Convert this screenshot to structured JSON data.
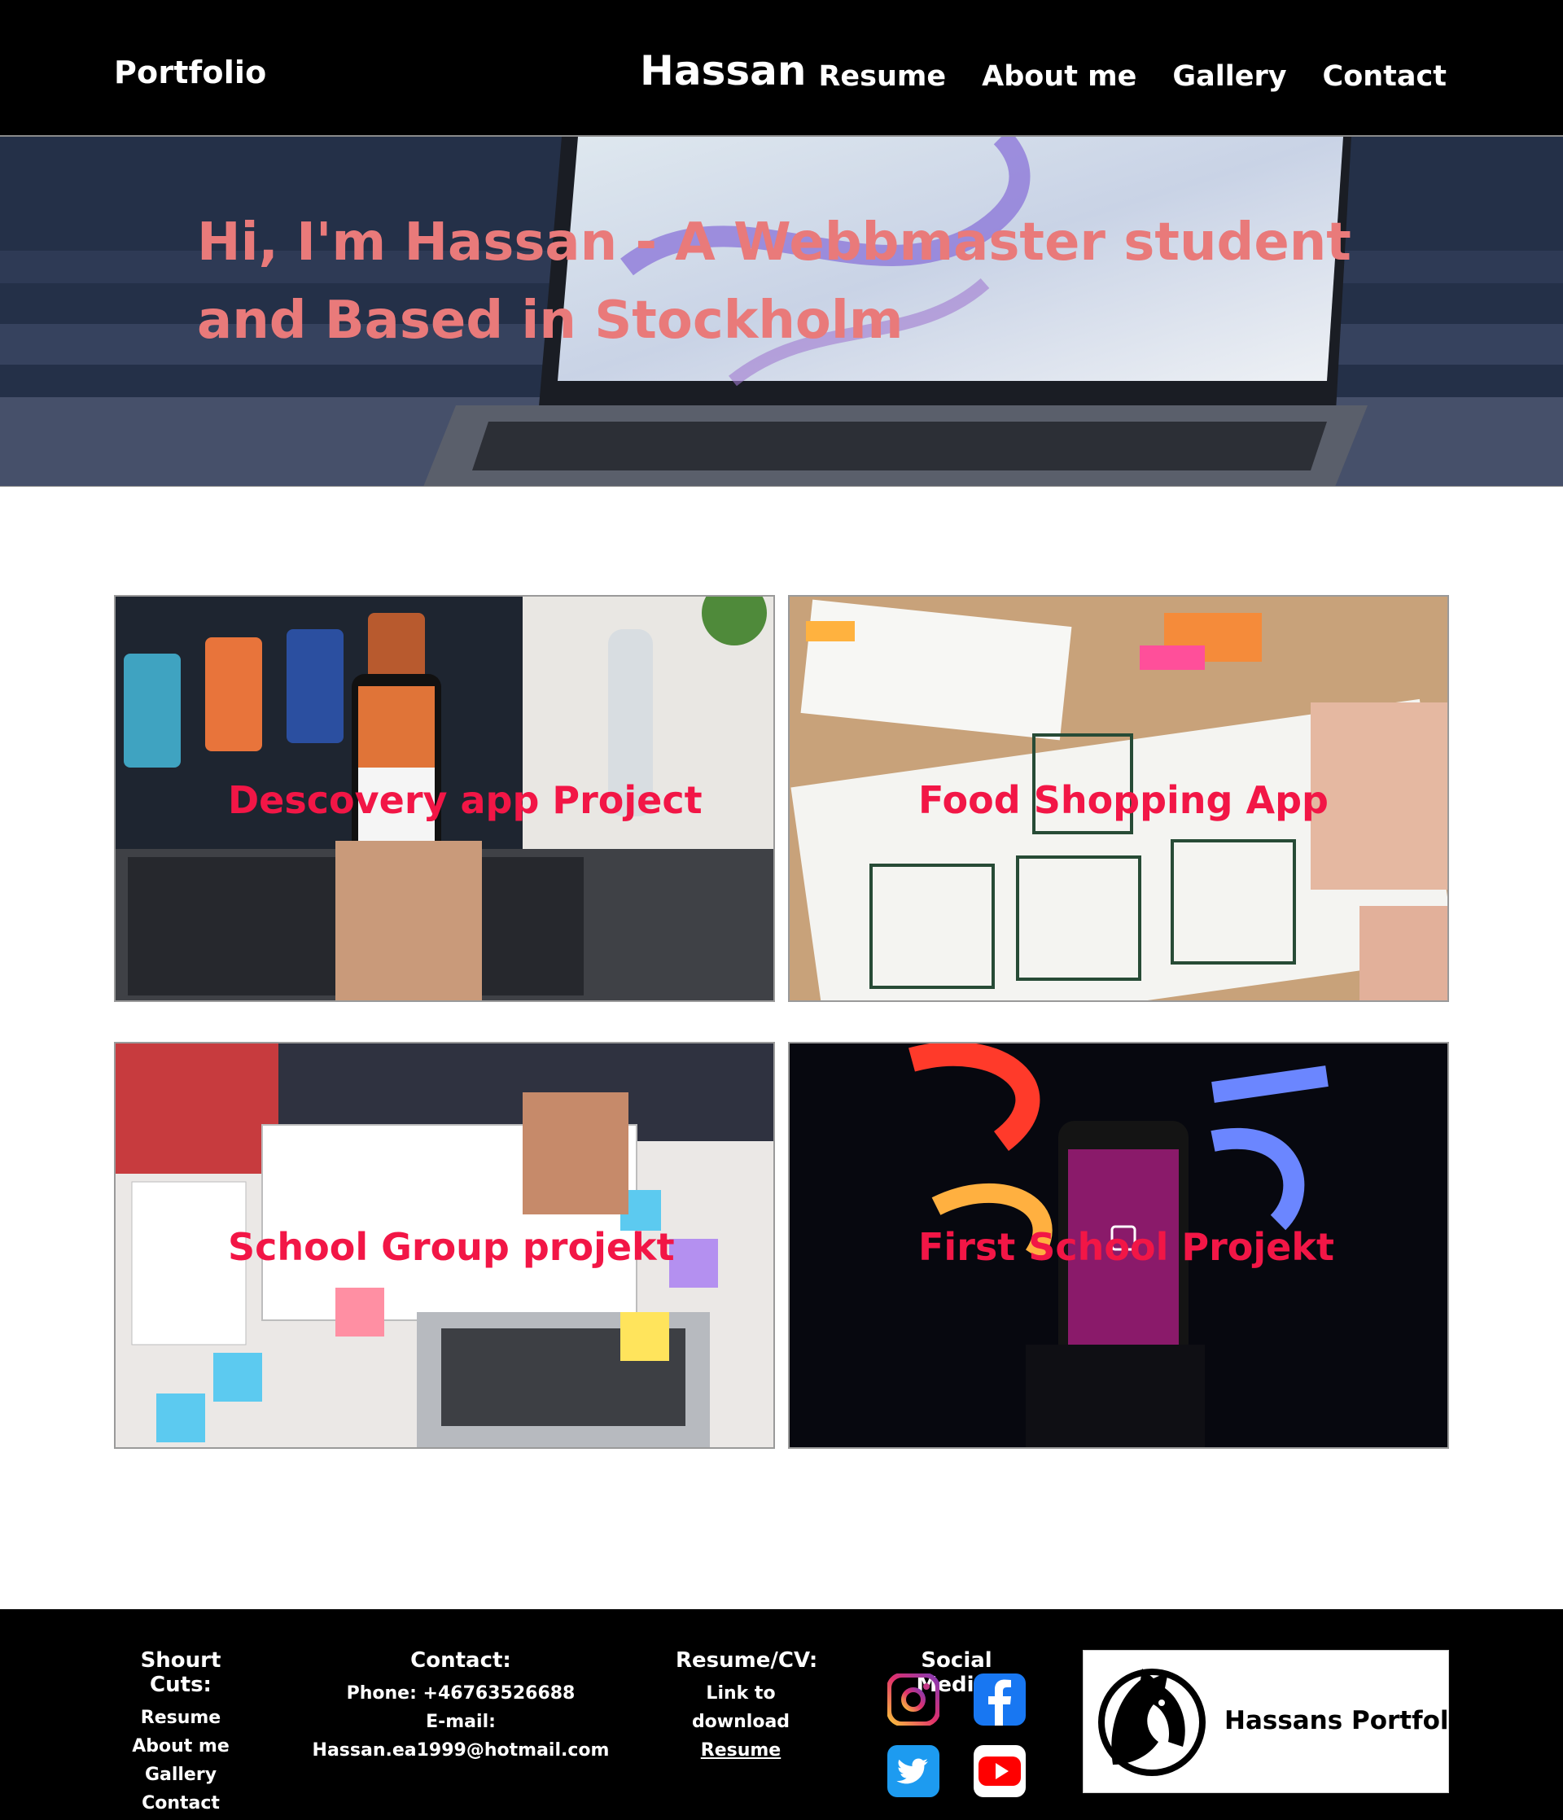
{
  "header": {
    "brand": "Portfolio",
    "site_name": "Hassan",
    "nav": [
      "Resume",
      "About me",
      "Gallery",
      "Contact"
    ]
  },
  "hero": {
    "heading": "Hi, I'm Hassan - A Webbmaster student and Based in Stockholm"
  },
  "projects": [
    {
      "title": "Descovery app Project"
    },
    {
      "title": "Food Shopping App"
    },
    {
      "title": "School Group projekt"
    },
    {
      "title": "First School Projekt"
    }
  ],
  "footer": {
    "shortcuts": {
      "title": "Shourt Cuts:",
      "links": [
        "Resume",
        "About me",
        "Gallery",
        "Contact"
      ]
    },
    "contact": {
      "title": "Contact:",
      "phone": "Phone: +46763526688",
      "email": "E-mail: Hassan.ea1999@hotmail.com"
    },
    "resume": {
      "title": "Resume/CV:",
      "line1": "Link to",
      "line2": "download",
      "link": "Resume"
    },
    "social": {
      "title": "Social Media:",
      "icons": [
        "instagram-icon",
        "facebook-icon",
        "twitter-icon",
        "youtube-icon"
      ]
    },
    "logo_text": "Hassans Portfolio"
  },
  "colors": {
    "header_bg": "#000000",
    "hero_heading": "#e97a7a",
    "card_title": "#f21646"
  }
}
